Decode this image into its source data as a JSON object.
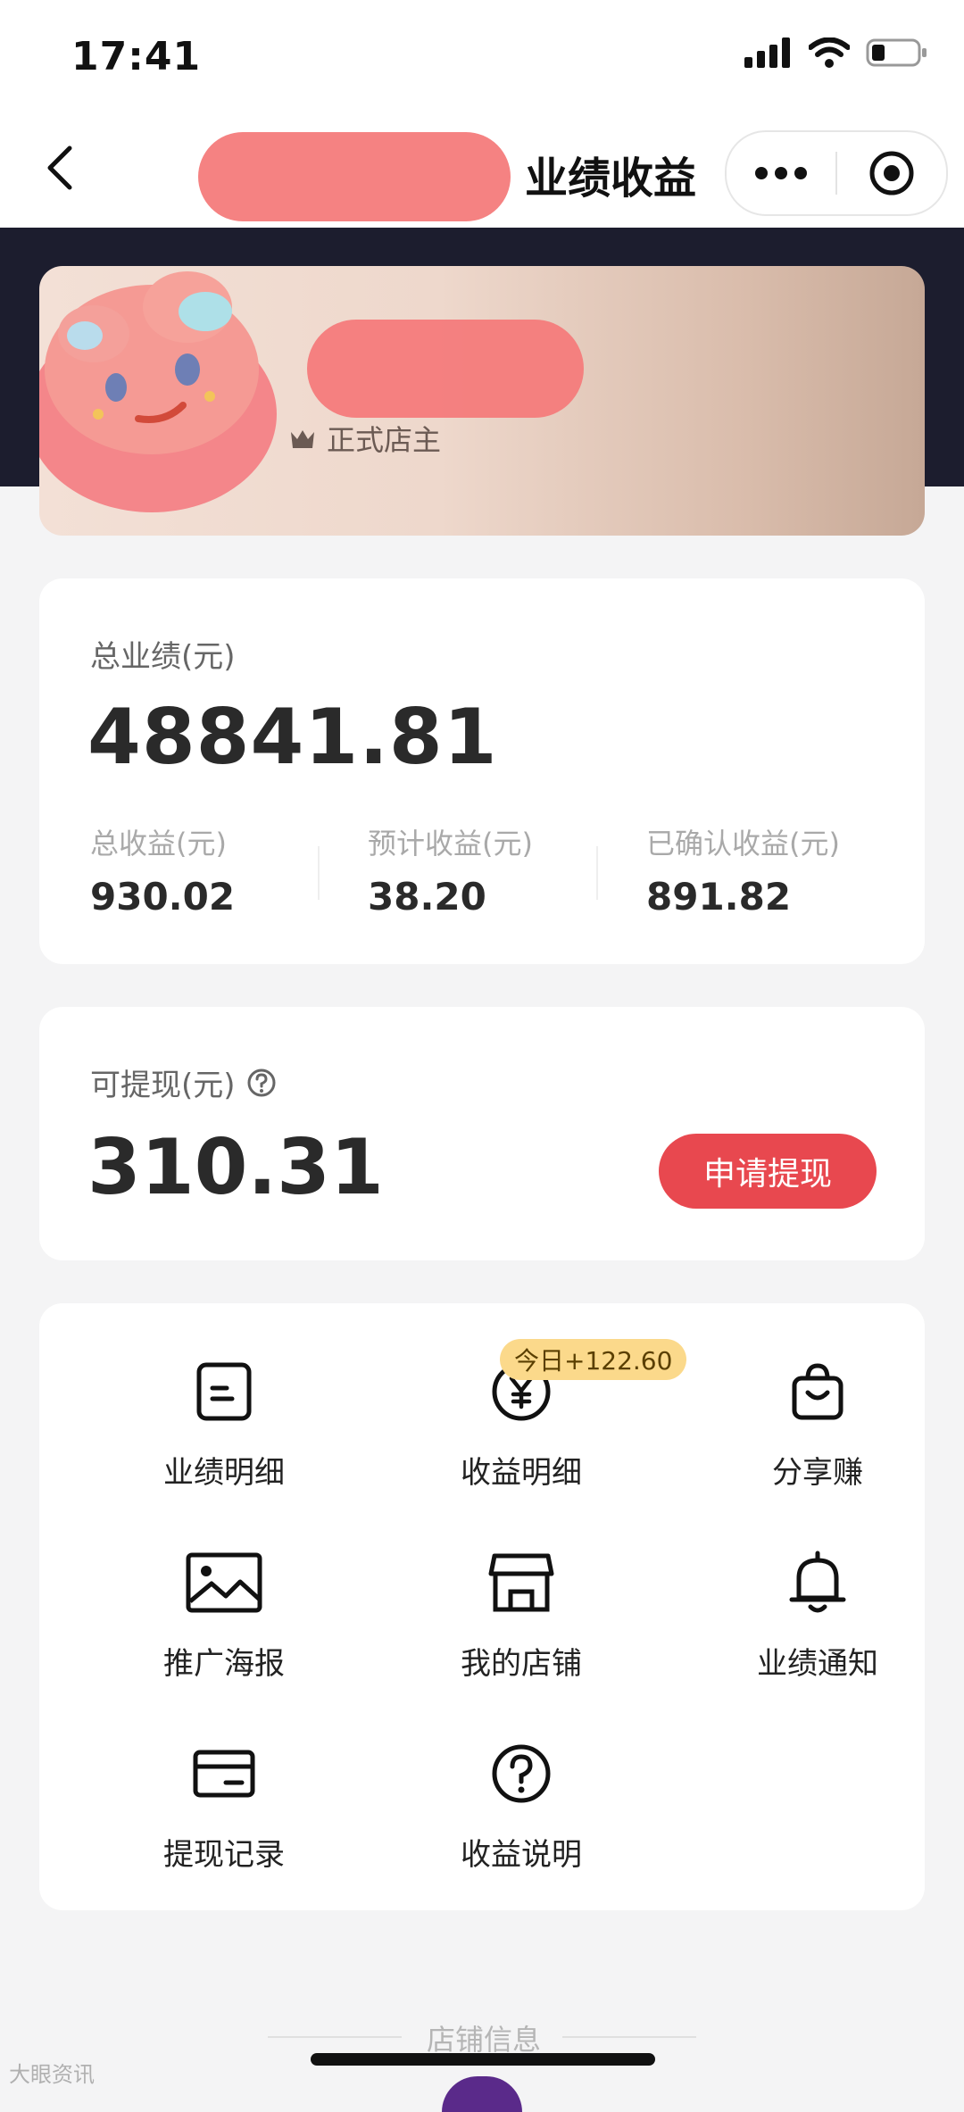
{
  "status_bar": {
    "time": "17:41"
  },
  "nav": {
    "title": "业绩收益"
  },
  "profile": {
    "tier_label": "正式店主"
  },
  "performance": {
    "total_label": "总业绩(元)",
    "total_value": "48841.81",
    "stats": [
      {
        "label": "总收益(元)",
        "value": "930.02"
      },
      {
        "label": "预计收益(元)",
        "value": "38.20"
      },
      {
        "label": "已确认收益(元)",
        "value": "891.82"
      }
    ]
  },
  "withdraw": {
    "label": "可提现(元)",
    "value": "310.31",
    "button": "申请提现"
  },
  "menu": {
    "badge": "今日+122.60",
    "items": [
      {
        "label": "业绩明细",
        "icon": "document-icon"
      },
      {
        "label": "收益明细",
        "icon": "yen-coin-icon"
      },
      {
        "label": "分享赚",
        "icon": "shopping-bag-icon"
      },
      {
        "label": "推广海报",
        "icon": "image-icon"
      },
      {
        "label": "我的店铺",
        "icon": "store-icon"
      },
      {
        "label": "业绩通知",
        "icon": "bell-icon"
      },
      {
        "label": "提现记录",
        "icon": "card-icon"
      },
      {
        "label": "收益说明",
        "icon": "question-icon"
      }
    ]
  },
  "footer": {
    "section_label": "店铺信息",
    "watermark": "大眼资讯"
  },
  "colors": {
    "accent": "#e8484f",
    "dark_band": "#1c1d2e",
    "badge": "#fbd98b"
  }
}
